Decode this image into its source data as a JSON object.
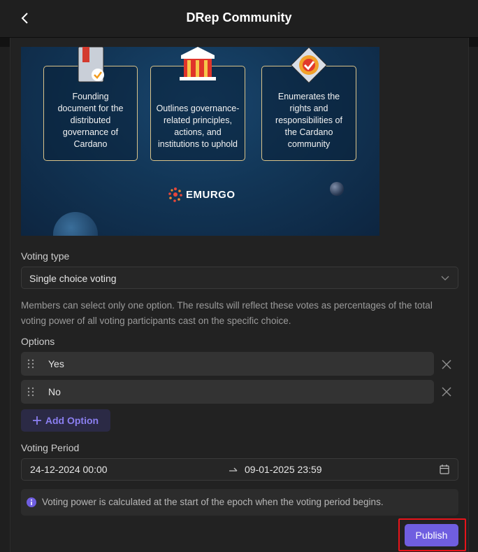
{
  "header": {
    "title": "DRep Community"
  },
  "banner": {
    "cards": [
      {
        "text": "Founding document for the distributed governance of Cardano",
        "icon": "document-check-icon"
      },
      {
        "text": "Outlines governance-related principles, actions, and institutions to uphold",
        "icon": "institution-icon"
      },
      {
        "text": "Enumerates the rights and responsibilities of the Cardano community",
        "icon": "badge-check-icon"
      }
    ],
    "brand": "EMURGO"
  },
  "voting_type": {
    "label": "Voting type",
    "selected": "Single choice voting",
    "description": "Members can select only one option. The results will reflect these votes as percentages of the total voting power of all voting participants cast on the specific choice."
  },
  "options": {
    "label": "Options",
    "items": [
      {
        "value": "Yes"
      },
      {
        "value": "No"
      }
    ],
    "add_label": "Add Option"
  },
  "voting_period": {
    "label": "Voting Period",
    "start": "24-12-2024 00:00",
    "end": "09-01-2025 23:59"
  },
  "info": {
    "text": "Voting power is calculated at the start of the epoch when the voting period begins."
  },
  "actions": {
    "publish_label": "Publish"
  },
  "colors": {
    "accent": "#6f5ee0",
    "highlight": "#e8141a",
    "card_border": "#d9c38a"
  }
}
